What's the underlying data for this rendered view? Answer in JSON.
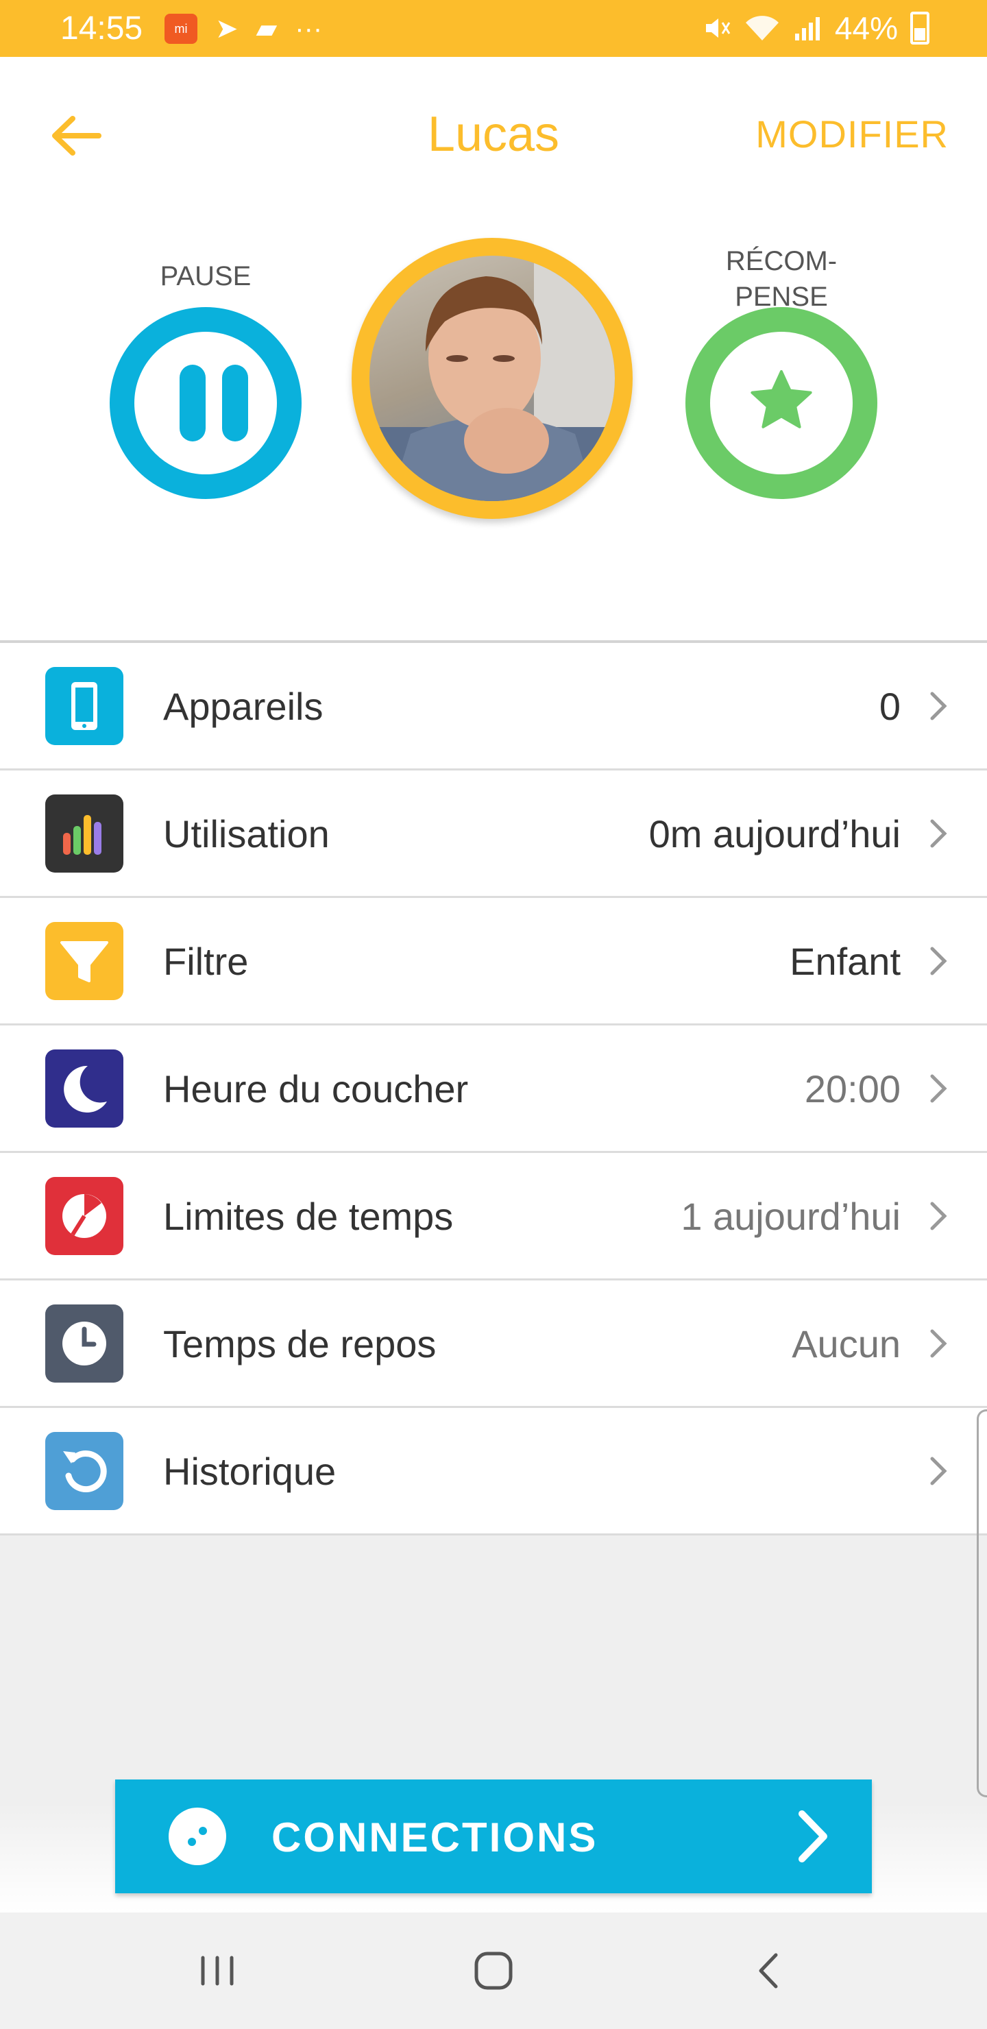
{
  "status_bar": {
    "time": "14:55",
    "battery": "44%",
    "app_badge": "mi",
    "more": "···"
  },
  "header": {
    "title": "Lucas",
    "modify_label": "MODIFIER"
  },
  "controls": {
    "pause_label": "PAUSE",
    "reward_label_line1": "RÉCOM-",
    "reward_label_line2": "PENSE"
  },
  "list": {
    "items": [
      {
        "label": "Appareils",
        "value": "0",
        "icon": "tablet-icon",
        "color": "#0ab1dc"
      },
      {
        "label": "Utilisation",
        "value": "0m aujourd’hui",
        "icon": "bar-chart-icon",
        "color": "#333333"
      },
      {
        "label": "Filtre",
        "value": "Enfant",
        "icon": "filter-icon",
        "color": "#fcbd2c"
      },
      {
        "label": "Heure du coucher",
        "value": "20:00",
        "icon": "moon-icon",
        "color": "#302e8c"
      },
      {
        "label": "Limites de temps",
        "value": "1 aujourd’hui",
        "icon": "timer-icon",
        "color": "#e0303a"
      },
      {
        "label": "Temps de repos",
        "value": "Aucun",
        "icon": "clock-icon",
        "color": "#505a6b"
      },
      {
        "label": "Historique",
        "value": "",
        "icon": "history-icon",
        "color": "#4f9fd6"
      }
    ]
  },
  "connections": {
    "label": "CONNECTIONS"
  },
  "colors": {
    "accent": "#fcbd2c",
    "pause": "#0ab1dc",
    "reward": "#6bcb67"
  }
}
